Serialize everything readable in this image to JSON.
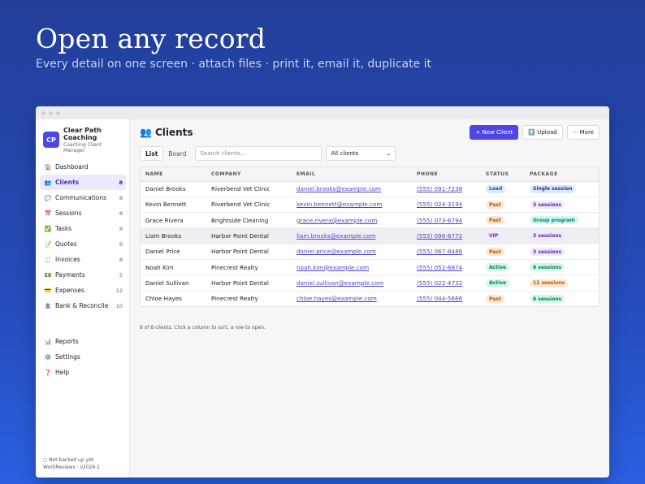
{
  "hero": {
    "title": "Open any record",
    "subtitle": "Every detail on one screen · attach files · print it, email it, duplicate it"
  },
  "brand": {
    "initials": "CP",
    "name": "Clear Path Coaching",
    "tagline": "Coaching Client Manager"
  },
  "sidebar": {
    "items": [
      {
        "icon": "🏠",
        "icon_name": "home-icon",
        "label": "Dashboard",
        "count": ""
      },
      {
        "icon": "👥",
        "icon_name": "clients-icon",
        "label": "Clients",
        "count": "8",
        "active": true
      },
      {
        "icon": "💬",
        "icon_name": "chat-icon",
        "label": "Communications",
        "count": "8"
      },
      {
        "icon": "📅",
        "icon_name": "calendar-icon",
        "label": "Sessions",
        "count": "8"
      },
      {
        "icon": "✅",
        "icon_name": "check-icon",
        "label": "Tasks",
        "count": "8"
      },
      {
        "icon": "📝",
        "icon_name": "memo-icon",
        "label": "Quotes",
        "count": "6"
      },
      {
        "icon": "🧾",
        "icon_name": "receipt-icon",
        "label": "Invoices",
        "count": "8"
      },
      {
        "icon": "💵",
        "icon_name": "money-icon",
        "label": "Payments",
        "count": "5"
      },
      {
        "icon": "💳",
        "icon_name": "card-icon",
        "label": "Expenses",
        "count": "12"
      },
      {
        "icon": "🏦",
        "icon_name": "bank-icon",
        "label": "Bank & Reconcile",
        "count": "10"
      }
    ],
    "secondary": [
      {
        "icon": "📊",
        "icon_name": "chart-icon",
        "label": "Reports"
      },
      {
        "icon": "⚙️",
        "icon_name": "gear-icon",
        "label": "Settings"
      },
      {
        "icon": "❓",
        "icon_name": "help-icon",
        "label": "Help"
      }
    ],
    "footer_status": "○ Not backed up yet",
    "footer_version": "WorkReviews · v2026.1"
  },
  "header": {
    "icon": "👥",
    "title": "Clients",
    "new_label": "+ New Client",
    "upload_label": "⬆️ Upload",
    "more_label": "··· More"
  },
  "toolbar": {
    "view_list": "List",
    "view_board": "Board",
    "search_placeholder": "Search clients...",
    "filter_value": "All clients"
  },
  "table": {
    "columns": [
      "NAME",
      "COMPANY",
      "EMAIL",
      "PHONE",
      "STATUS",
      "PACKAGE"
    ],
    "rows": [
      {
        "name": "Daniel Brooks",
        "company": "Riverbend Vet Clinic",
        "email": "daniel.brooks@example.com",
        "phone": "(555) 091-7238",
        "status": "Lead",
        "package": "Single session"
      },
      {
        "name": "Kevin Bennett",
        "company": "Riverbend Vet Clinic",
        "email": "kevin.bennett@example.com",
        "phone": "(555) 024-3194",
        "status": "Past",
        "package": "3 sessions"
      },
      {
        "name": "Grace Rivera",
        "company": "Brightside Cleaning",
        "email": "grace.rivera@example.com",
        "phone": "(555) 073-6794",
        "status": "Past",
        "package": "Group program"
      },
      {
        "name": "Liam Brooks",
        "company": "Harbor Point Dental",
        "email": "liam.brooks@example.com",
        "phone": "(555) 096-6772",
        "status": "VIP",
        "package": "3 sessions"
      },
      {
        "name": "Daniel Price",
        "company": "Harbor Point Dental",
        "email": "daniel.price@example.com",
        "phone": "(555) 067-8486",
        "status": "Past",
        "package": "3 sessions"
      },
      {
        "name": "Noah Kim",
        "company": "Pinecrest Realty",
        "email": "noah.kim@example.com",
        "phone": "(555) 052-6874",
        "status": "Active",
        "package": "6 sessions"
      },
      {
        "name": "Daniel Sullivan",
        "company": "Harbor Point Dental",
        "email": "daniel.sullivan@example.com",
        "phone": "(555) 022-4732",
        "status": "Active",
        "package": "12 sessions"
      },
      {
        "name": "Chloe Hayes",
        "company": "Pinecrest Realty",
        "email": "chloe.hayes@example.com",
        "phone": "(555) 044-5666",
        "status": "Past",
        "package": "6 sessions"
      }
    ],
    "footnote": "8 of 8 clients. Click a column to sort, a row to open."
  },
  "colors": {
    "accent": "#4f46e5",
    "status": {
      "Lead": {
        "bg": "#dbeafe",
        "fg": "#1d4ed8"
      },
      "Past": {
        "bg": "#fde8cf",
        "fg": "#b45309"
      },
      "VIP": {
        "bg": "#ede9fe",
        "fg": "#6d28d9"
      },
      "Active": {
        "bg": "#d1fae5",
        "fg": "#047857"
      }
    },
    "package": {
      "Single session": {
        "bg": "#dbeafe",
        "fg": "#1e3a8a"
      },
      "3 sessions": {
        "bg": "#ede9fe",
        "fg": "#5b21b6"
      },
      "Group program": {
        "bg": "#ccfbf1",
        "fg": "#0f766e"
      },
      "6 sessions": {
        "bg": "#d1fae5",
        "fg": "#047857"
      },
      "12 sessions": {
        "bg": "#fde8cf",
        "fg": "#b45309"
      }
    }
  }
}
